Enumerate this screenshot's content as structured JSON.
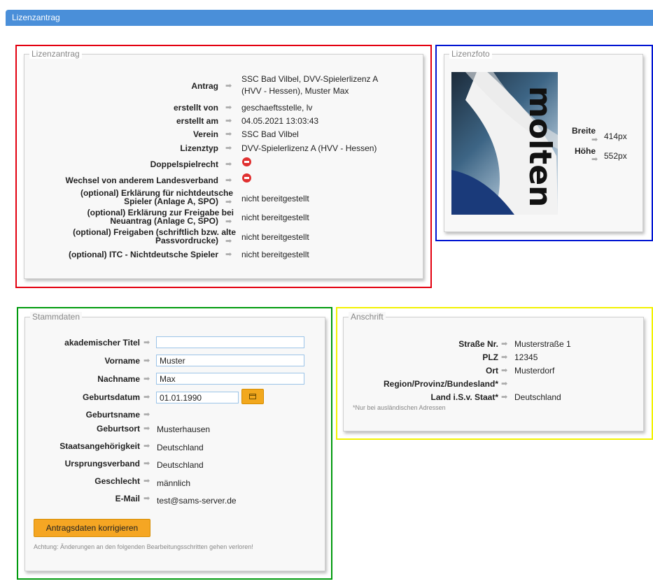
{
  "header": {
    "title": "Lizenzantrag"
  },
  "colors": {
    "red": "#e3000f",
    "blue": "#0014d2",
    "green": "#009a0d",
    "yellow": "#f2f200",
    "accent": "#f5a623",
    "topbar": "#4a8fd9"
  },
  "license": {
    "legend": "Lizenzantrag",
    "rows": [
      {
        "label": "Antrag",
        "value": "SSC Bad Vilbel, DVV-Spielerlizenz A",
        "value2": "(HVV - Hessen), Muster Max"
      },
      {
        "label": "erstellt von",
        "value": "geschaeftsstelle, lv"
      },
      {
        "label": "erstellt am",
        "value": "04.05.2021 13:03:43"
      },
      {
        "label": "Verein",
        "value": "SSC Bad Vilbel"
      },
      {
        "label": "Lizenztyp",
        "value": "DVV-Spielerlizenz A (HVV - Hessen)"
      },
      {
        "label": "Doppelspielrecht",
        "icon": "no-entry-icon"
      },
      {
        "label": "Wechsel von anderem Landesverband",
        "icon": "no-entry-icon"
      },
      {
        "label": "(optional) Erklärung für nichtdeutsche",
        "label2": "Spieler (Anlage A, SPO)",
        "value": "nicht bereitgestellt"
      },
      {
        "label": "(optional) Erklärung zur Freigabe bei",
        "label2": "Neuantrag (Anlage C, SPO)",
        "value": "nicht bereitgestellt"
      },
      {
        "label": "(optional) Freigaben (schriftlich bzw. alte",
        "label2": "Passvordrucke)",
        "value": "nicht bereitgestellt"
      },
      {
        "label": "(optional) ITC - Nichtdeutsche Spieler",
        "value": "nicht bereitgestellt"
      }
    ]
  },
  "photo": {
    "legend": "Lizenzfoto",
    "image_text": "molten",
    "width_label": "Breite",
    "width_value": "414px",
    "height_label": "Höhe",
    "height_value": "552px"
  },
  "master": {
    "legend": "Stammdaten",
    "title_label": "akademischer Titel",
    "title_value": "",
    "firstname_label": "Vorname",
    "firstname_value": "Muster",
    "lastname_label": "Nachname",
    "lastname_value": "Max",
    "birthdate_label": "Geburtsdatum",
    "birthdate_value": "01.01.1990",
    "birthname_label": "Geburtsname",
    "birthplace_label": "Geburtsort",
    "birthplace_value": "Musterhausen",
    "nationality_label": "Staatsangehörigkeit",
    "nationality_value": "Deutschland",
    "origin_label": "Ursprungsverband",
    "origin_value": "Deutschland",
    "gender_label": "Geschlecht",
    "gender_value": "männlich",
    "email_label": "E-Mail",
    "email_value": "test@sams-server.de",
    "correct_button": "Antragsdaten korrigieren",
    "warning": "Achtung: Änderungen an den folgenden Bearbeitungsschritten gehen verloren!"
  },
  "address": {
    "legend": "Anschrift",
    "street_label": "Straße Nr.",
    "street_value": "Musterstraße 1",
    "zip_label": "PLZ",
    "zip_value": "12345",
    "city_label": "Ort",
    "city_value": "Musterdorf",
    "region_label": "Region/Provinz/Bundesland*",
    "country_label": "Land i.S.v. Staat*",
    "country_value": "Deutschland",
    "footnote": "*Nur bei ausländischen Adressen"
  }
}
